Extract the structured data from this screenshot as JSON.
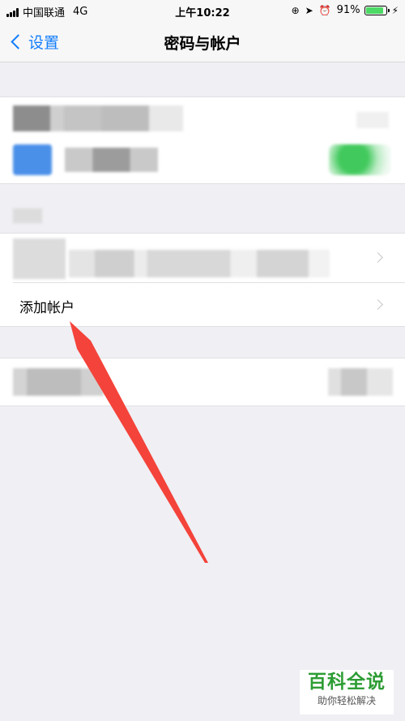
{
  "status_bar": {
    "carrier": "中国联通",
    "network": "4G",
    "time": "上午10:22",
    "battery_percent": "91%",
    "battery_level": 0.91
  },
  "nav": {
    "back_label": "设置",
    "title": "密码与帐户"
  },
  "accounts": {
    "add_account_label": "添加帐户"
  },
  "annotation": {
    "arrow_color": "#f4433a"
  },
  "watermark": {
    "title": "百科全说",
    "subtitle": "助你轻松解决"
  }
}
